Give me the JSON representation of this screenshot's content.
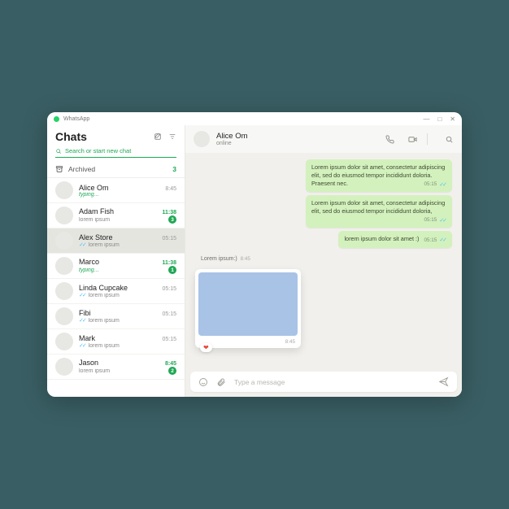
{
  "app": {
    "name": "WhatsApp"
  },
  "window_controls": {
    "minimize": "—",
    "maximize": "□",
    "close": "✕"
  },
  "sidebar": {
    "title": "Chats",
    "search_placeholder": "Search or start new chat",
    "archived": {
      "label": "Archived",
      "count": "3"
    },
    "chats": [
      {
        "name": "Alice Om",
        "time": "8:45",
        "preview": "typing...",
        "typing": true,
        "unread": 0,
        "ticks": false
      },
      {
        "name": "Adam Fish",
        "time": "11:38",
        "preview": "lorem ipsum",
        "typing": false,
        "unread": 3,
        "ticks": false
      },
      {
        "name": "Alex Store",
        "time": "05:15",
        "preview": "lorem ipsum",
        "typing": false,
        "unread": 0,
        "ticks": true,
        "selected": true
      },
      {
        "name": "Marco",
        "time": "11:38",
        "preview": "typing...",
        "typing": true,
        "unread": 1,
        "ticks": false
      },
      {
        "name": "Linda Cupcake",
        "time": "05:15",
        "preview": "lorem ipsum",
        "typing": false,
        "unread": 0,
        "ticks": true
      },
      {
        "name": "Fibi",
        "time": "05:15",
        "preview": "lorem ipsum",
        "typing": false,
        "unread": 0,
        "ticks": true
      },
      {
        "name": "Mark",
        "time": "05:15",
        "preview": "lorem ipsum",
        "typing": false,
        "unread": 0,
        "ticks": true
      },
      {
        "name": "Jason",
        "time": "8:45",
        "preview": "lorem ipsum",
        "typing": false,
        "unread": 2,
        "ticks": false
      }
    ]
  },
  "conversation": {
    "contact": {
      "name": "Alice Om",
      "status": "online"
    },
    "messages": [
      {
        "dir": "out",
        "text": "Lorem ipsum dolor sit amet, consectetur adipiscing elit, sed do eiusmod tempor incididunt doloria. Praesent nec.",
        "time": "05:15",
        "ticks": true
      },
      {
        "dir": "out",
        "text": "Lorem ipsum dolor sit amet, consectetur adipiscing elit, sed do eiusmod tempor incididunt doloria,",
        "time": "05:15",
        "ticks": true
      },
      {
        "dir": "out",
        "text": "lorem ipsum dolor sit amet :)",
        "time": "05:15",
        "ticks": true
      },
      {
        "dir": "in-label",
        "text": "Lorem ipsum:)",
        "time": "8:45"
      },
      {
        "dir": "in-image",
        "time": "8:45",
        "reactions": "❤"
      }
    ],
    "composer_placeholder": "Type a message"
  }
}
